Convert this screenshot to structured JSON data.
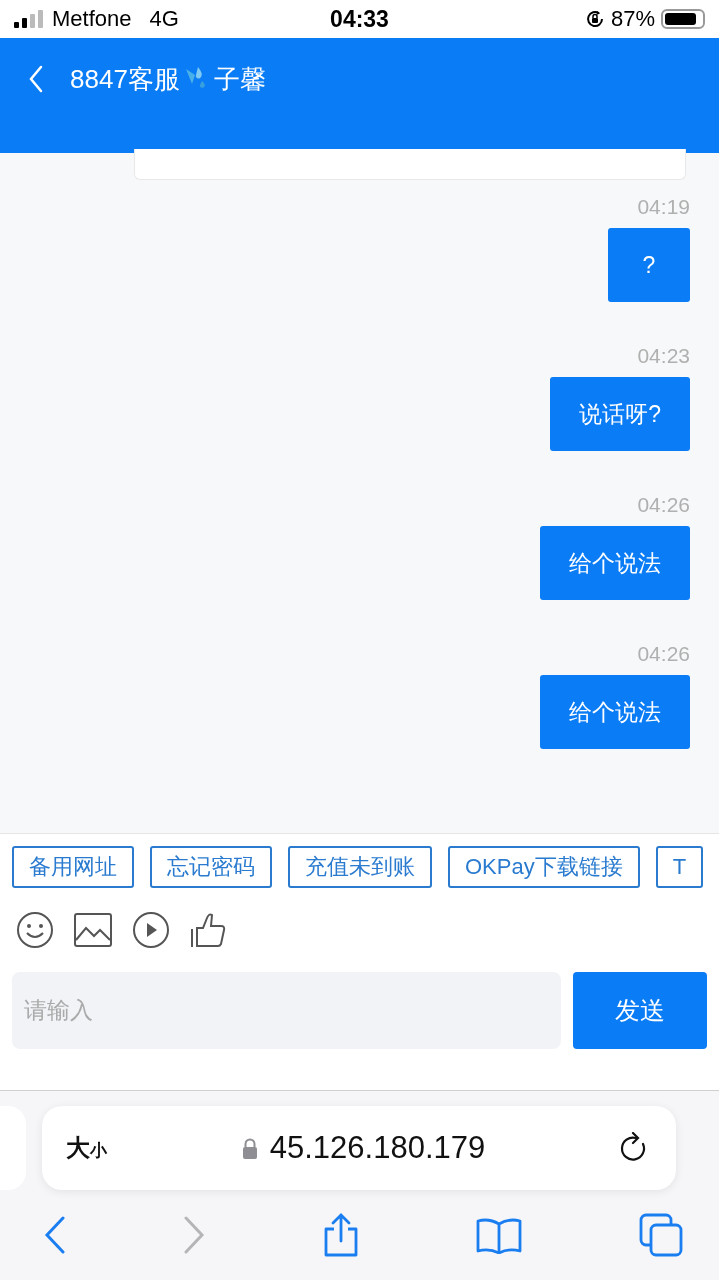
{
  "status_bar": {
    "carrier": "Metfone",
    "network": "4G",
    "time": "04:33",
    "battery": "87%"
  },
  "header": {
    "title_start": "8847客服",
    "title_end": "子馨"
  },
  "messages": [
    {
      "time": "04:19",
      "text": "?"
    },
    {
      "time": "04:23",
      "text": "说话呀?"
    },
    {
      "time": "04:26",
      "text": "给个说法"
    },
    {
      "time": "04:26",
      "text": "给个说法"
    }
  ],
  "quick_replies": [
    "备用网址",
    "忘记密码",
    "充值未到账",
    "OKPay下载链接",
    "T"
  ],
  "composer": {
    "placeholder": "请输入",
    "send": "发送"
  },
  "browser": {
    "text_size_large": "大",
    "text_size_small": "小",
    "address": "45.126.180.179",
    "forward_disabled": true
  }
}
